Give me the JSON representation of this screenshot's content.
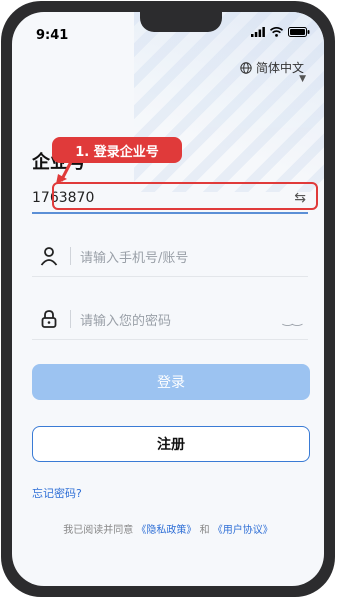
{
  "status_bar": {
    "time": "9:41"
  },
  "language": {
    "label": "简体中文"
  },
  "company": {
    "label": "企业号",
    "value": "1763870"
  },
  "annotation": {
    "text": "1. 登录企业号"
  },
  "account": {
    "placeholder": "请输入手机号/账号"
  },
  "password": {
    "placeholder": "请输入您的密码"
  },
  "buttons": {
    "login": "登录",
    "register": "注册"
  },
  "links": {
    "forgot": "忘记密码?"
  },
  "agreement": {
    "prefix": "我已阅读并同意",
    "privacy": "《隐私政策》",
    "and": "和",
    "terms": "《用户协议》"
  },
  "colors": {
    "accent": "#3a7bd5",
    "login_button": "#9cc3f1",
    "annotation": "#e03a3a"
  }
}
